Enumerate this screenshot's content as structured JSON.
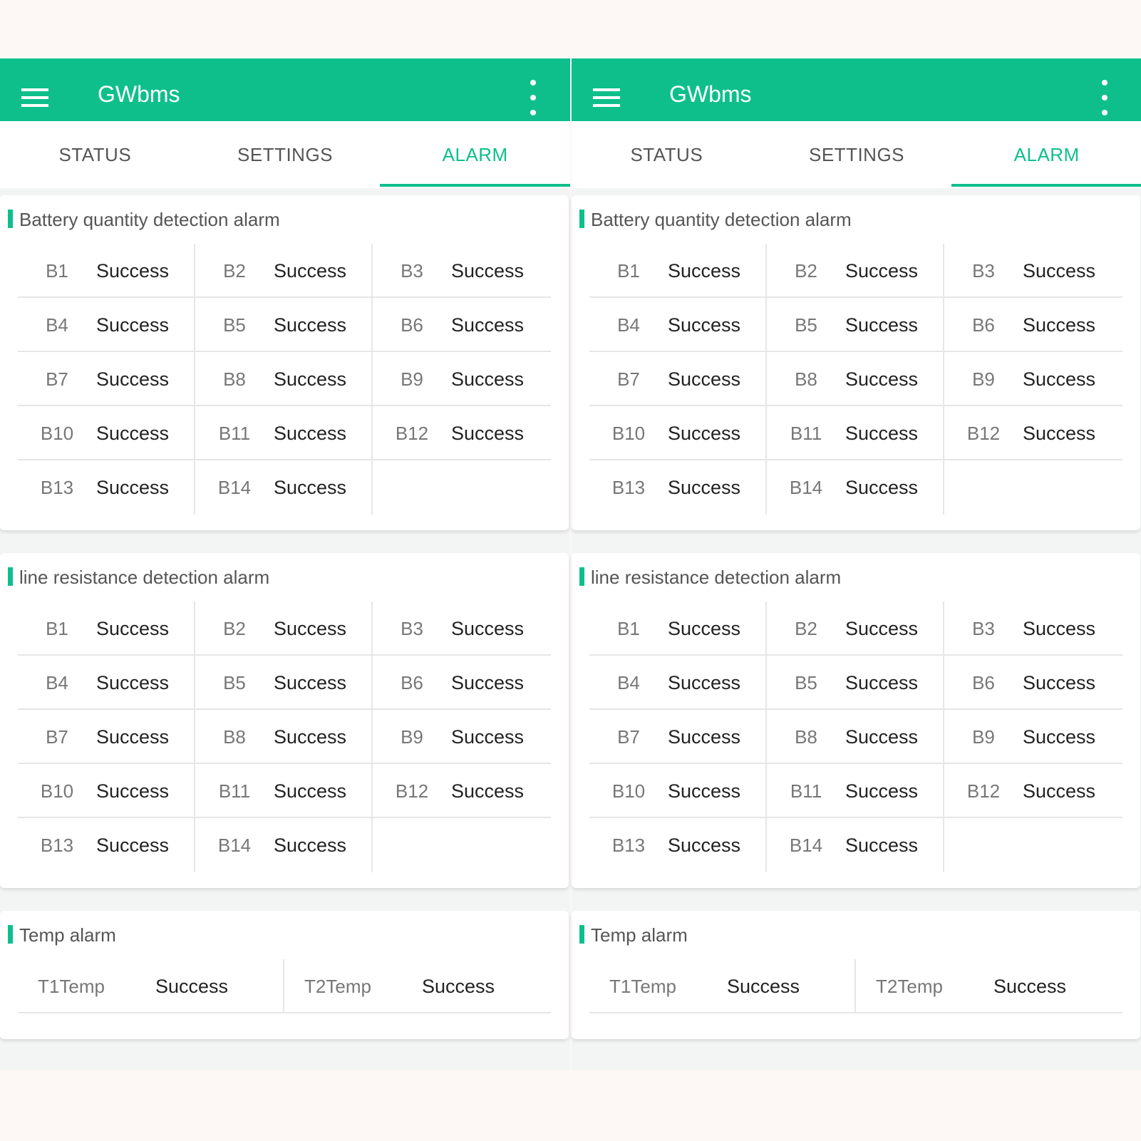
{
  "app": {
    "title": "GWbms"
  },
  "tabs": [
    {
      "label": "STATUS",
      "active": false
    },
    {
      "label": "SETTINGS",
      "active": false
    },
    {
      "label": "ALARM",
      "active": true
    }
  ],
  "colors": {
    "accent": "#0ebf8c",
    "background": "#fdf7f6",
    "card": "#ffffff",
    "label_text": "#777777",
    "value_text": "#222222"
  },
  "sections": [
    {
      "title": "Battery quantity detection alarm",
      "items": [
        {
          "label": "B1",
          "value": "Success"
        },
        {
          "label": "B2",
          "value": "Success"
        },
        {
          "label": "B3",
          "value": "Success"
        },
        {
          "label": "B4",
          "value": "Success"
        },
        {
          "label": "B5",
          "value": "Success"
        },
        {
          "label": "B6",
          "value": "Success"
        },
        {
          "label": "B7",
          "value": "Success"
        },
        {
          "label": "B8",
          "value": "Success"
        },
        {
          "label": "B9",
          "value": "Success"
        },
        {
          "label": "B10",
          "value": "Success"
        },
        {
          "label": "B11",
          "value": "Success"
        },
        {
          "label": "B12",
          "value": "Success"
        },
        {
          "label": "B13",
          "value": "Success"
        },
        {
          "label": "B14",
          "value": "Success"
        }
      ]
    },
    {
      "title": "line resistance detection alarm",
      "items": [
        {
          "label": "B1",
          "value": "Success"
        },
        {
          "label": "B2",
          "value": "Success"
        },
        {
          "label": "B3",
          "value": "Success"
        },
        {
          "label": "B4",
          "value": "Success"
        },
        {
          "label": "B5",
          "value": "Success"
        },
        {
          "label": "B6",
          "value": "Success"
        },
        {
          "label": "B7",
          "value": "Success"
        },
        {
          "label": "B8",
          "value": "Success"
        },
        {
          "label": "B9",
          "value": "Success"
        },
        {
          "label": "B10",
          "value": "Success"
        },
        {
          "label": "B11",
          "value": "Success"
        },
        {
          "label": "B12",
          "value": "Success"
        },
        {
          "label": "B13",
          "value": "Success"
        },
        {
          "label": "B14",
          "value": "Success"
        }
      ]
    },
    {
      "title": "Temp alarm",
      "items": [
        {
          "label": "T1Temp",
          "value": "Success"
        },
        {
          "label": "T2Temp",
          "value": "Success"
        }
      ]
    }
  ]
}
